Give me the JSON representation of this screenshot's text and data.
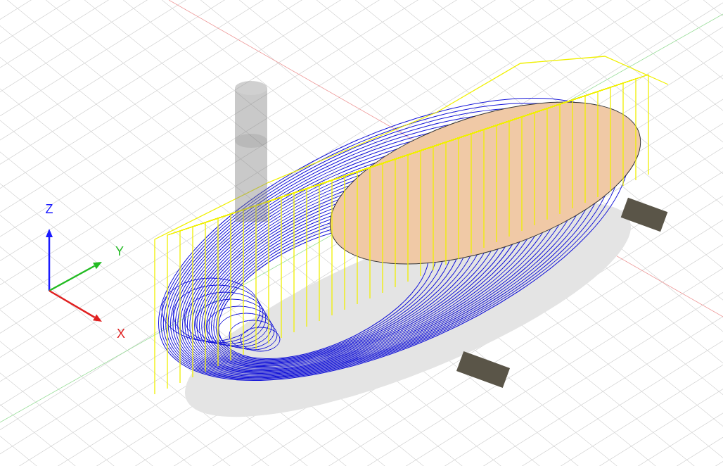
{
  "axes": [
    {
      "label": "Z",
      "color": "#1a1aff"
    },
    {
      "label": "Y",
      "color": "#22bb22"
    },
    {
      "label": "X",
      "color": "#e02020"
    }
  ]
}
